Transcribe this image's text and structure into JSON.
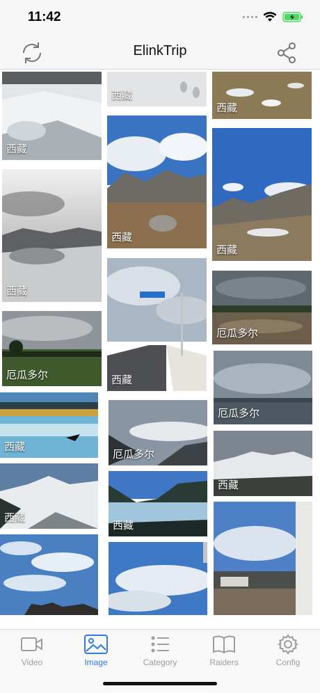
{
  "status": {
    "time": "11:42"
  },
  "nav": {
    "title": "ElinkTrip",
    "refresh_icon": "refresh-icon",
    "share_icon": "share-icon"
  },
  "gallery": {
    "captions": [
      "西藏",
      "西藏",
      "西藏",
      "西藏",
      "西藏",
      "厄瓜多尔",
      "西藏",
      "西藏",
      "厄瓜多尔",
      "西藏",
      "厄瓜多尔",
      "西藏",
      "西藏",
      "西藏",
      "西藏"
    ]
  },
  "tabs": [
    {
      "label": "Video",
      "icon": "video-icon"
    },
    {
      "label": "Image",
      "icon": "image-icon",
      "active": true
    },
    {
      "label": "Category",
      "icon": "list-icon"
    },
    {
      "label": "Raiders",
      "icon": "book-icon"
    },
    {
      "label": "Config",
      "icon": "gear-icon"
    }
  ],
  "colors": {
    "accent": "#2f7ae5",
    "inactive": "#9d9d9d",
    "battery": "#4cd964"
  }
}
